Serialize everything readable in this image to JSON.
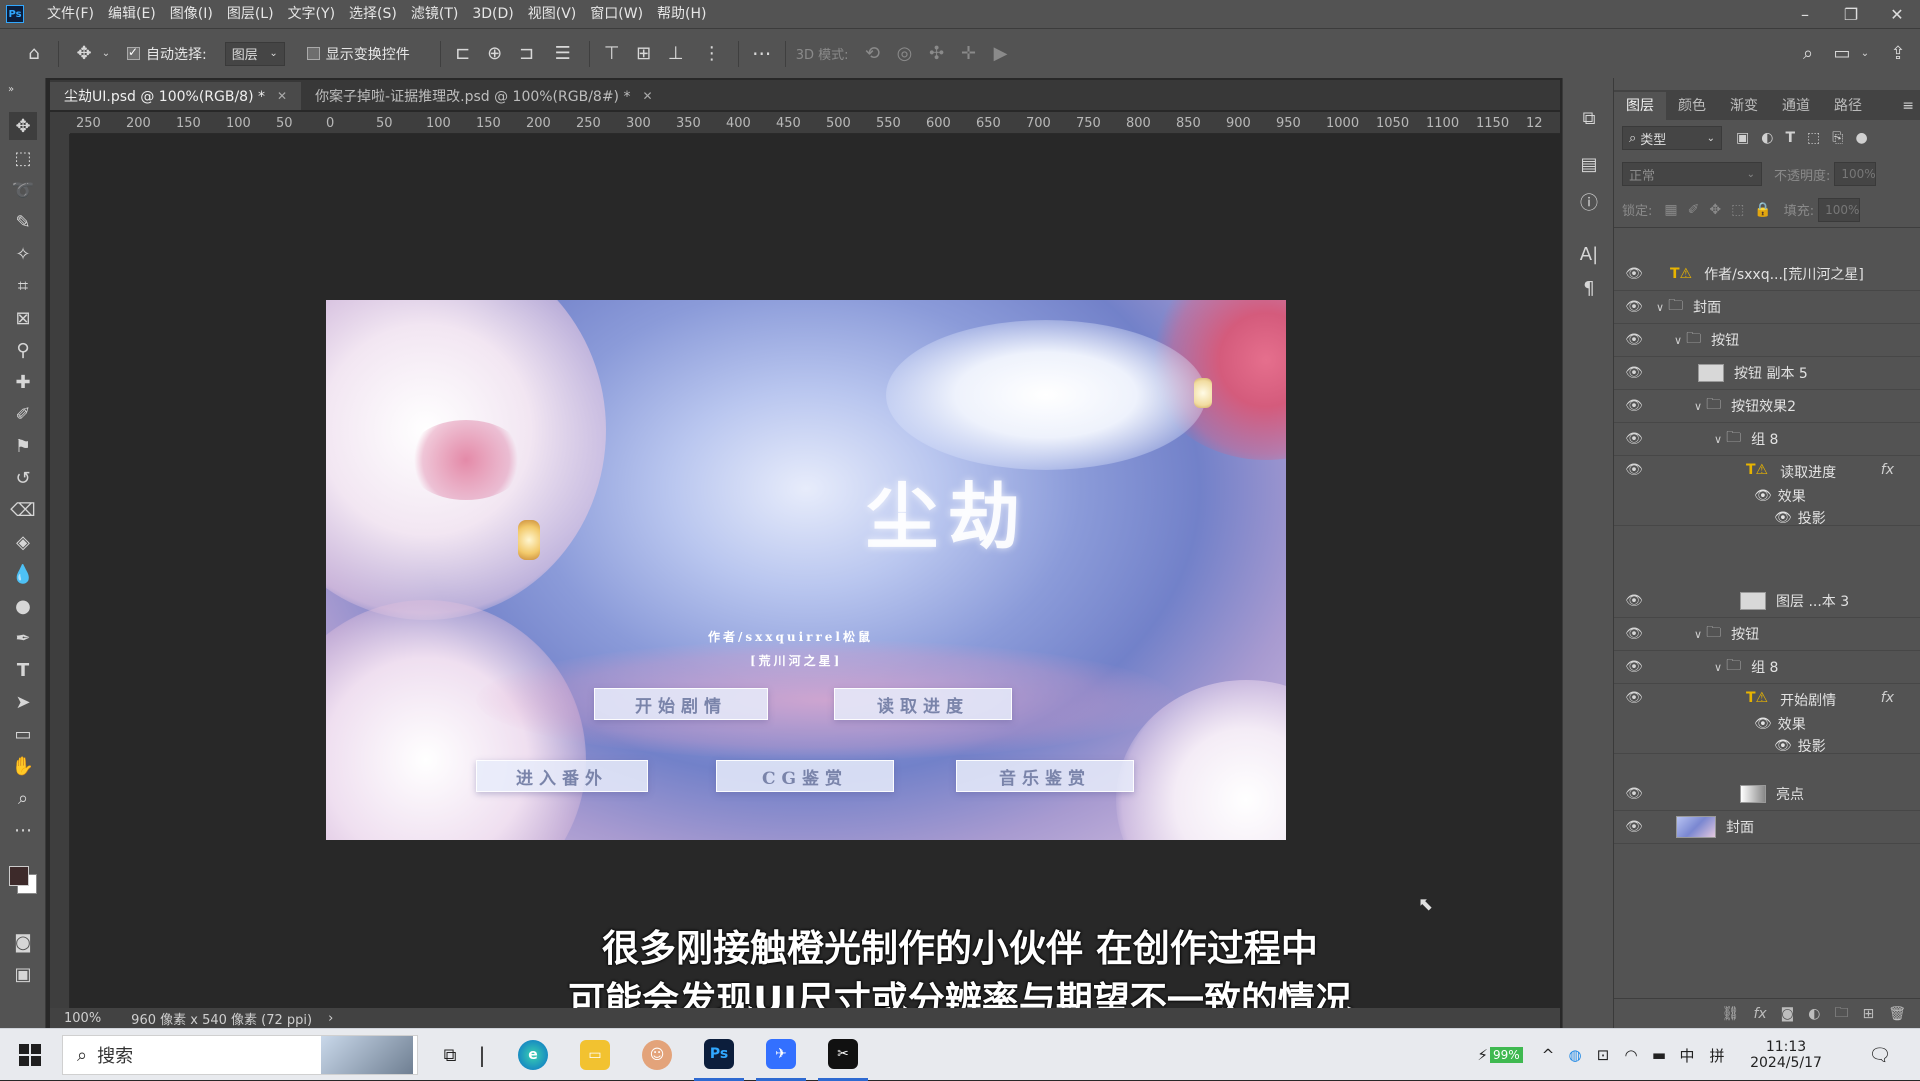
{
  "menubar": {
    "logo": "Ps",
    "items": [
      "文件(F)",
      "编辑(E)",
      "图像(I)",
      "图层(L)",
      "文字(Y)",
      "选择(S)",
      "滤镜(T)",
      "3D(D)",
      "视图(V)",
      "窗口(W)",
      "帮助(H)"
    ]
  },
  "optbar": {
    "auto_select_label": "自动选择:",
    "auto_select_value": "图层",
    "show_transform_label": "显示变换控件",
    "mode_3d_label": "3D 模式:",
    "more": "···"
  },
  "tabs": [
    {
      "label": "尘劫UI.psd @ 100%(RGB/8) *",
      "active": true
    },
    {
      "label": "你案子掉啦-证据推理改.psd @ 100%(RGB/8#) *",
      "active": false
    }
  ],
  "ruler": {
    "h_ticks": [
      "250",
      "200",
      "150",
      "100",
      "50",
      "0",
      "50",
      "100",
      "150",
      "200",
      "250",
      "300",
      "350",
      "400",
      "450",
      "500",
      "550",
      "600",
      "650",
      "700",
      "750",
      "800",
      "850",
      "900",
      "950",
      "1000",
      "1050",
      "1100",
      "1150",
      "12"
    ]
  },
  "artwork": {
    "title": "尘劫",
    "author_line": "作者/sxxquirrel松鼠",
    "author_line2": "[荒川河之星]",
    "buttons": [
      "开始剧情",
      "读取进度",
      "进入番外",
      "CG鉴赏",
      "音乐鉴赏"
    ]
  },
  "subtitles": {
    "line1": "很多刚接触橙光制作的小伙伴 在创作过程中",
    "line2": "可能会发现UI尺寸或分辨率与期望不一致的情况"
  },
  "status": {
    "zoom": "100%",
    "doc_info": "960 像素 x 540 像素 (72 ppi)",
    "arrow": "›"
  },
  "layers_panel": {
    "tabs": [
      "图层",
      "颜色",
      "渐变",
      "通道",
      "路径"
    ],
    "filter_kind": "类型",
    "blend_mode": "正常",
    "opacity_label": "不透明度:",
    "opacity_value": "100%",
    "lock_label": "锁定:",
    "fill_label": "填充:",
    "fill_value": "100%",
    "layers": [
      {
        "name": "作者/sxxq...[荒川河之星]",
        "kind": "text"
      },
      {
        "name": "封面",
        "kind": "group"
      },
      {
        "name": "按钮",
        "kind": "group"
      },
      {
        "name": "按钮 副本 5",
        "kind": "pixel"
      },
      {
        "name": "按钮效果2",
        "kind": "group"
      },
      {
        "name": "组 8",
        "kind": "group"
      },
      {
        "name": "读取进度",
        "kind": "text",
        "fx": "fx"
      },
      {
        "name": "效果",
        "kind": "effect"
      },
      {
        "name": "投影",
        "kind": "effect"
      },
      {
        "name": "图层 ...本 3",
        "kind": "pixel"
      },
      {
        "name": "按钮",
        "kind": "group"
      },
      {
        "name": "组 8",
        "kind": "group"
      },
      {
        "name": "开始剧情",
        "kind": "text",
        "fx": "fx"
      },
      {
        "name": "效果",
        "kind": "effect"
      },
      {
        "name": "投影",
        "kind": "effect"
      },
      {
        "name": "亮点",
        "kind": "pixel"
      },
      {
        "name": "封面",
        "kind": "image"
      }
    ]
  },
  "taskbar": {
    "search_placeholder": "搜索",
    "battery": "99%",
    "ime": "中",
    "ime2": "拼",
    "time": "11:13",
    "date": "2024/5/17"
  }
}
